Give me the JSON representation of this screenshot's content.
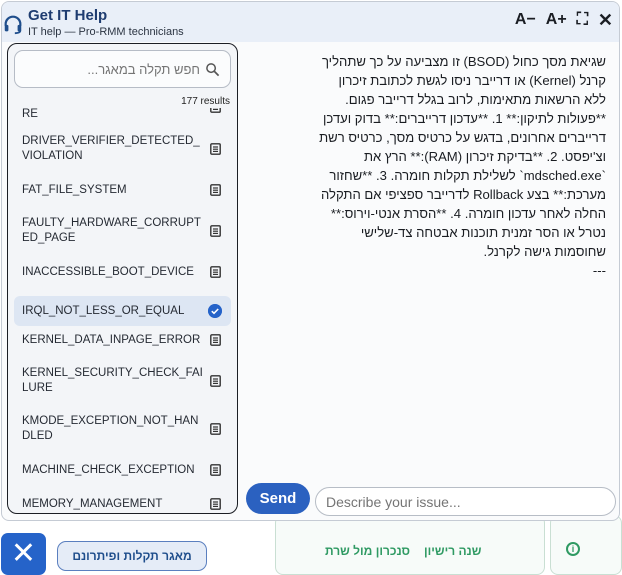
{
  "header": {
    "title": "Get IT Help",
    "subtitle": "IT help — Pro-RMM technicians",
    "font_decrease": "A−",
    "font_increase": "A+",
    "expand_icon": "⛶",
    "close_icon": "✕"
  },
  "search": {
    "placeholder": "חפש תקלה במאגר...",
    "results_count": "177 results"
  },
  "list": [
    {
      "label": "DRIVER_POWER_STATE_FAILURE",
      "selected": false
    },
    {
      "label": "DRIVER_VERIFIER_DETECTED_VIOLATION",
      "selected": false
    },
    {
      "label": "FAT_FILE_SYSTEM",
      "selected": false
    },
    {
      "label": "FAULTY_HARDWARE_CORRUPTED_PAGE",
      "selected": false
    },
    {
      "label": "INACCESSIBLE_BOOT_DEVICE",
      "selected": false
    },
    {
      "label": "IRQL_NOT_LESS_OR_EQUAL",
      "selected": true
    },
    {
      "label": "KERNEL_DATA_INPAGE_ERROR",
      "selected": false
    },
    {
      "label": "KERNEL_SECURITY_CHECK_FAILURE",
      "selected": false
    },
    {
      "label": "KMODE_EXCEPTION_NOT_HANDLED",
      "selected": false
    },
    {
      "label": "MACHINE_CHECK_EXCEPTION",
      "selected": false
    },
    {
      "label": "MEMORY_MANAGEMENT",
      "selected": false
    }
  ],
  "content_lines": [
    "שגיאת מסך כחול (BSOD) זו מצביעה על כך שתהליך",
    "קרנל (Kernel) או דרייבר ניסו לגשת לכתובת זיכרון",
    "ללא הרשאות מתאימות, לרוב בגלל דרייבר פגום.",
    "**פעולות לתיקון:** 1. **עדכון דרייברים:** בדוק ועדכן",
    "דרייברים אחרונים, בדגש על כרטיס מסך, כרטיס רשת",
    "וצ'יפסט. 2. **בדיקת זיכרון (RAM):** הרץ את",
    "`mdsched.exe` לשלילת תקלות חומרה. 3. **שחזור",
    "מערכת:** בצע Rollback לדרייבר ספציפי אם התקלה",
    "החלה לאחר עדכון חומרה. 4. **הסרת אנטי-וירוס:**",
    "נטרל או הסר זמנית תוכנות אבטחה צד-שלישי",
    "שחוסמות גישה לקרנל.",
    "---"
  ],
  "composer": {
    "send_label": "Send",
    "input_placeholder": "Describe your issue..."
  },
  "footer": {
    "close_icon": "✕",
    "kb_button": "מאגר תקלות ופיתרונם"
  },
  "background": {
    "link_1": "סנכרון מול שרת",
    "link_2": "שנה רישיון",
    "info_icon": "i"
  }
}
